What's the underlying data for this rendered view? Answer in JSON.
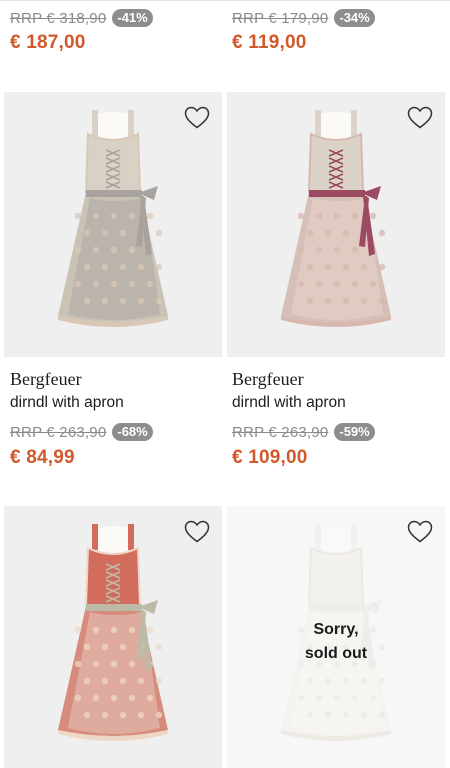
{
  "products": [
    {
      "rrp": "RRP € 318,90",
      "discount": "-41%",
      "price": "€ 187,00"
    },
    {
      "rrp": "RRP € 179,90",
      "discount": "-34%",
      "price": "€ 119,00"
    },
    {
      "brand": "Bergfeuer",
      "type": "dirndl with apron",
      "rrp": "RRP € 263,90",
      "discount": "-68%",
      "price": "€ 84,99",
      "colors": {
        "bodice": "#d8d2c6",
        "skirt": "#c9c2b5",
        "apron": "#b9b2ac",
        "bow": "#a8a39e",
        "lace": "#d9c7b5"
      }
    },
    {
      "brand": "Bergfeuer",
      "type": "dirndl with apron",
      "rrp": "RRP € 263,90",
      "discount": "-59%",
      "price": "€ 109,00",
      "colors": {
        "bodice": "#dcd3c8",
        "skirt": "#d4c0b6",
        "apron": "#e2cbc3",
        "bow": "#9b4a62",
        "lace": "#d8b7ae"
      }
    },
    {
      "colors": {
        "bodice": "#d26d5d",
        "skirt": "#d68c7d",
        "apron": "#e0b0a3",
        "bow": "#bdbba8",
        "lace": "#efd7c5"
      }
    },
    {
      "sold_out_line1": "Sorry,",
      "sold_out_line2": "sold out",
      "colors": {
        "bodice": "#f3f1ee",
        "skirt": "#f5f3f0",
        "apron": "#f7f5f2",
        "bow": "#efede9",
        "lace": "#ece8e3"
      }
    }
  ],
  "icons": {
    "wishlist": "heart-outline-icon"
  },
  "accent_price_color": "#d0592b",
  "badge_color": "#8d8d8d"
}
